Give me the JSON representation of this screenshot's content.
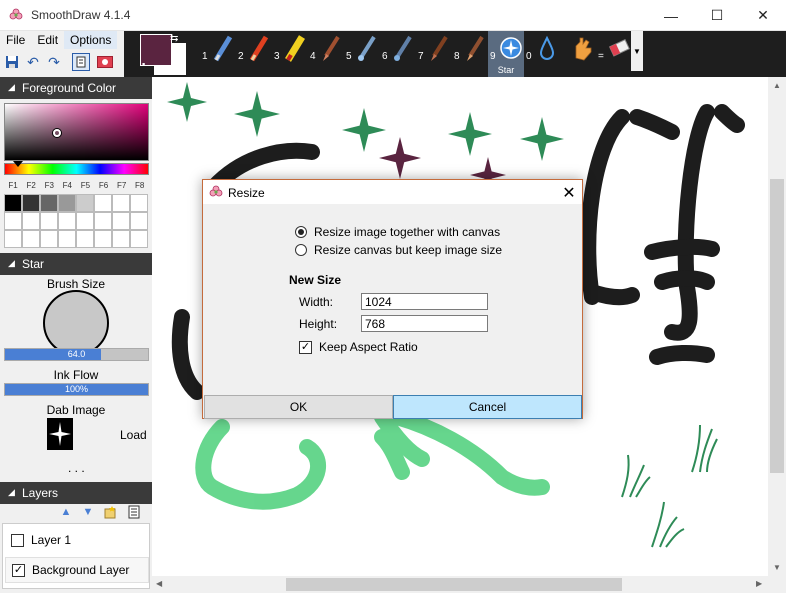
{
  "window": {
    "title": "SmoothDraw 4.1.4",
    "minimize_glyph": "—",
    "maximize_glyph": "☐",
    "close_glyph": "✕"
  },
  "menu": {
    "items": [
      "File",
      "Edit",
      "Options"
    ]
  },
  "colors": {
    "foreground": "#5a2440",
    "background": "#ffffff",
    "accent": "#4a7fd4",
    "selected_brush": "#5a6b80"
  },
  "brushes": [
    {
      "num": "1",
      "icon": "pen-icon"
    },
    {
      "num": "2",
      "icon": "pencil-icon"
    },
    {
      "num": "3",
      "icon": "highlighter-icon"
    },
    {
      "num": "4",
      "icon": "brush-icon"
    },
    {
      "num": "5",
      "icon": "airbrush-icon"
    },
    {
      "num": "6",
      "icon": "airbrush-icon"
    },
    {
      "num": "7",
      "icon": "brush-icon"
    },
    {
      "num": "8",
      "icon": "brush-icon"
    },
    {
      "num": "9",
      "icon": "star-brush-icon",
      "label": "Star"
    },
    {
      "num": "0",
      "icon": "water-drop-icon"
    },
    {
      "num": "",
      "icon": "smudge-hand-icon"
    },
    {
      "num": "=",
      "icon": "eraser-icon"
    }
  ],
  "panels": {
    "foreground_color": "Foreground Color",
    "brush": "Star",
    "layers": "Layers"
  },
  "fkeys": [
    "F1",
    "F2",
    "F3",
    "F4",
    "F5",
    "F6",
    "F7",
    "F8"
  ],
  "swatches": [
    "#000000",
    "#333333",
    "#666666",
    "#999999",
    "#cccccc",
    "#ffffff",
    "#ffffff",
    "#ffffff",
    "#ffffff",
    "#ffffff",
    "#ffffff",
    "#ffffff",
    "#ffffff",
    "#ffffff",
    "#ffffff",
    "#ffffff",
    "#ffffff",
    "#ffffff",
    "#ffffff",
    "#ffffff",
    "#ffffff",
    "#ffffff",
    "#ffffff",
    "#ffffff"
  ],
  "brush_settings": {
    "brush_size_label": "Brush Size",
    "brush_size_value": "64.0",
    "brush_size_fraction": 0.67,
    "ink_flow_label": "Ink Flow",
    "ink_flow_value": "100%",
    "ink_flow_fraction": 1.0,
    "dab_image_label": "Dab Image",
    "load_label": "Load",
    "more": ". . ."
  },
  "layers": [
    {
      "name": "Layer 1",
      "checked": false,
      "selected": false
    },
    {
      "name": "Background Layer",
      "checked": true,
      "selected": true
    }
  ],
  "dialog": {
    "title": "Resize",
    "close_glyph": "✕",
    "options": [
      {
        "label": "Resize image together with canvas",
        "selected": true
      },
      {
        "label": "Resize canvas but keep image size",
        "selected": false
      }
    ],
    "new_size_label": "New Size",
    "width_label": "Width:",
    "width_value": "1024",
    "height_label": "Height:",
    "height_value": "768",
    "keep_aspect_label": "Keep Aspect Ratio",
    "keep_aspect_checked": true,
    "ok_label": "OK",
    "cancel_label": "Cancel"
  }
}
